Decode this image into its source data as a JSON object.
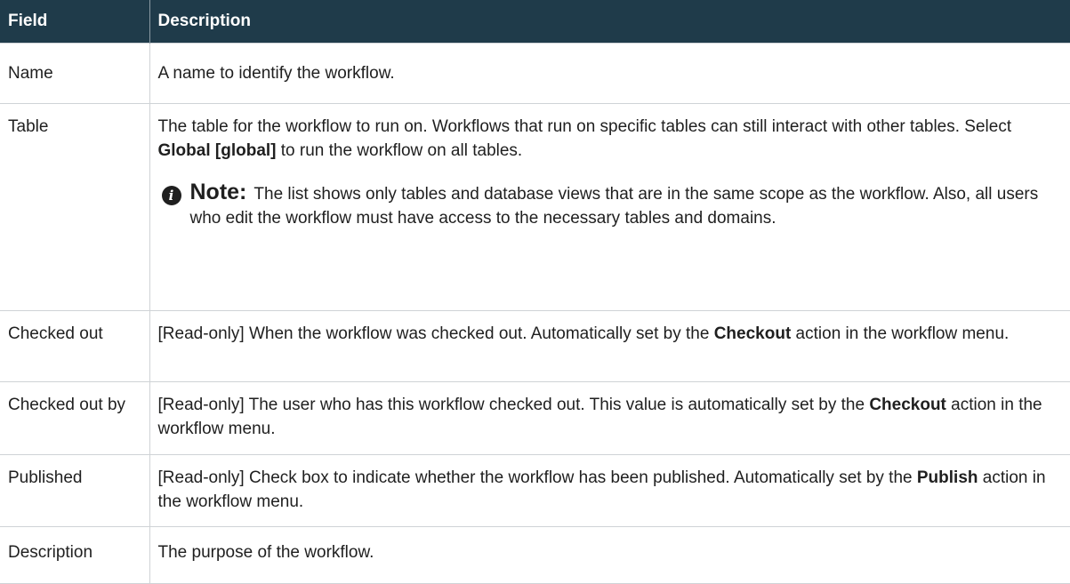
{
  "table": {
    "headers": [
      "Field",
      "Description"
    ],
    "rows": [
      {
        "field": "Name",
        "segments": [
          {
            "text": "A name to identify the workflow.",
            "bold": false
          }
        ]
      },
      {
        "field": "Table",
        "segments": [
          {
            "text": "The table for the workflow to run on. Workflows that run on specific tables can still interact with other tables. Select ",
            "bold": false
          },
          {
            "text": "Global [global]",
            "bold": true
          },
          {
            "text": " to run the workflow on all tables.",
            "bold": false
          }
        ],
        "note": {
          "title": "Note:",
          "text": "The list shows only tables and database views that are in the same scope as the workflow. Also, all users who edit the workflow must have access to the necessary tables and domains."
        }
      },
      {
        "field": "Checked out",
        "segments": [
          {
            "text": "[Read-only] When the workflow was checked out. Automatically set by the ",
            "bold": false
          },
          {
            "text": "Checkout",
            "bold": true
          },
          {
            "text": " action in the workflow menu.",
            "bold": false
          }
        ]
      },
      {
        "field": "Checked out by",
        "segments": [
          {
            "text": "[Read-only] The user who has this workflow checked out. This value is automatically set by the ",
            "bold": false
          },
          {
            "text": "Checkout",
            "bold": true
          },
          {
            "text": " action in the workflow menu.",
            "bold": false
          }
        ]
      },
      {
        "field": "Published",
        "segments": [
          {
            "text": "[Read-only] Check box to indicate whether the workflow has been published. Automatically set by the ",
            "bold": false
          },
          {
            "text": "Publish",
            "bold": true
          },
          {
            "text": " action in the workflow menu.",
            "bold": false
          }
        ]
      },
      {
        "field": "Description",
        "segments": [
          {
            "text": "The purpose of the workflow.",
            "bold": false
          }
        ]
      }
    ]
  },
  "icons": {
    "note": "info-icon",
    "note_glyph": "i"
  },
  "colors": {
    "header_bg": "#1f3b4a",
    "header_text": "#ffffff",
    "border": "#cfd3d6"
  }
}
